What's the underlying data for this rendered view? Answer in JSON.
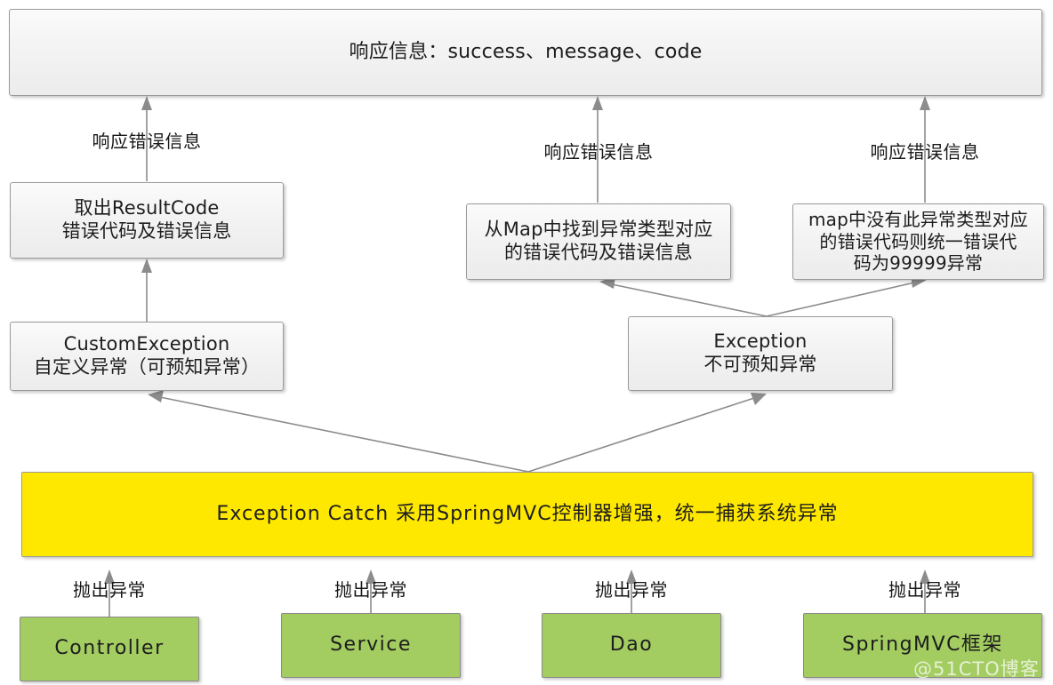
{
  "diagram": {
    "title_box": {
      "label": "响应信息：success、message、code"
    },
    "response_labels": {
      "left": "响应错误信息",
      "middle": "响应错误信息",
      "right": "响应错误信息"
    },
    "handler_boxes": {
      "left": "取出ResultCode\n错误代码及错误信息",
      "middle": "从Map中找到异常类型对应\n的错误代码及错误信息",
      "right": "map中没有此异常类型对应\n的错误代码则统一错误代\n码为99999异常"
    },
    "exception_boxes": {
      "custom": "CustomException\n自定义异常（可预知异常）",
      "general": "Exception\n不可预知异常"
    },
    "catch_bar": {
      "label": "Exception Catch 采用SpringMVC控制器增强，统一捕获系统异常"
    },
    "throw_labels": {
      "controller": "抛出异常",
      "service": "抛出异常",
      "dao": "抛出异常",
      "springmvc": "抛出异常"
    },
    "layer_boxes": {
      "controller": "Controller",
      "service": "Service",
      "dao": "Dao",
      "springmvc": "SpringMVC框架"
    },
    "watermark": "@51CTO博客",
    "colors": {
      "catch_bar": "#ffe800",
      "layer_box": "#a3cc61",
      "box_border": "#9a9a9a",
      "connector": "#8c8c8c",
      "text": "#1d1d1d"
    }
  }
}
